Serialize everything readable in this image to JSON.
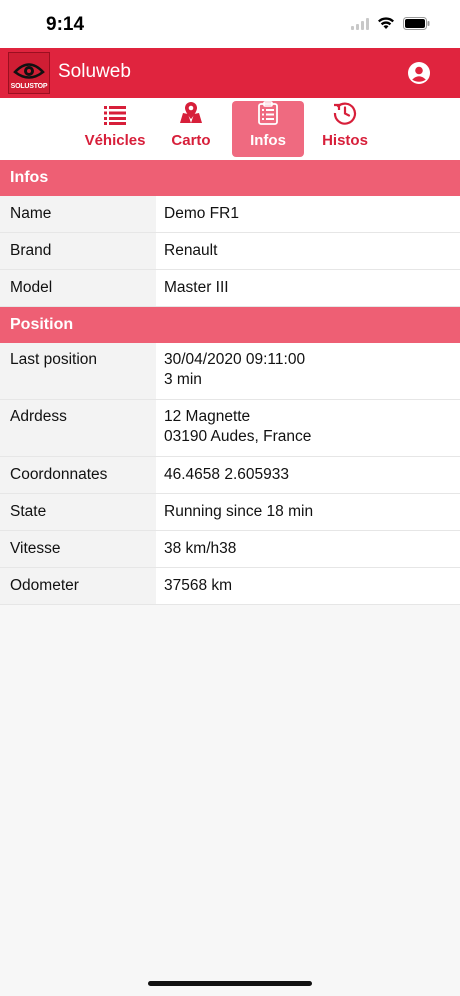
{
  "status": {
    "time": "9:14"
  },
  "appbar": {
    "title": "Soluweb",
    "logo_text": "SOLUSTOP",
    "accent": "#e0243e"
  },
  "tabs": [
    {
      "label": "Véhicles",
      "icon": "list-icon",
      "active": false
    },
    {
      "label": "Carto",
      "icon": "map-icon",
      "active": false
    },
    {
      "label": "Infos",
      "icon": "clipboard-icon",
      "active": true
    },
    {
      "label": "Histos",
      "icon": "history-icon",
      "active": false
    }
  ],
  "sections": {
    "infos": {
      "title": "Infos",
      "rows": [
        {
          "key": "Name",
          "value": "Demo FR1"
        },
        {
          "key": "Brand",
          "value": "Renault"
        },
        {
          "key": "Model",
          "value": "Master III"
        }
      ]
    },
    "position": {
      "title": "Position",
      "rows": [
        {
          "key": "Last position",
          "value_line1": "30/04/2020 09:11:00",
          "value_line2": "3 min"
        },
        {
          "key": "Adrdess",
          "value_line1": "12 Magnette",
          "value_line2": "03190 Audes, France"
        },
        {
          "key": "Coordonnates",
          "value": "46.4658 2.605933"
        },
        {
          "key": "State",
          "value": "Running since 18 min"
        },
        {
          "key": "Vitesse",
          "value": "38 km/h38"
        },
        {
          "key": "Odometer",
          "value": "37568 km"
        }
      ]
    }
  }
}
